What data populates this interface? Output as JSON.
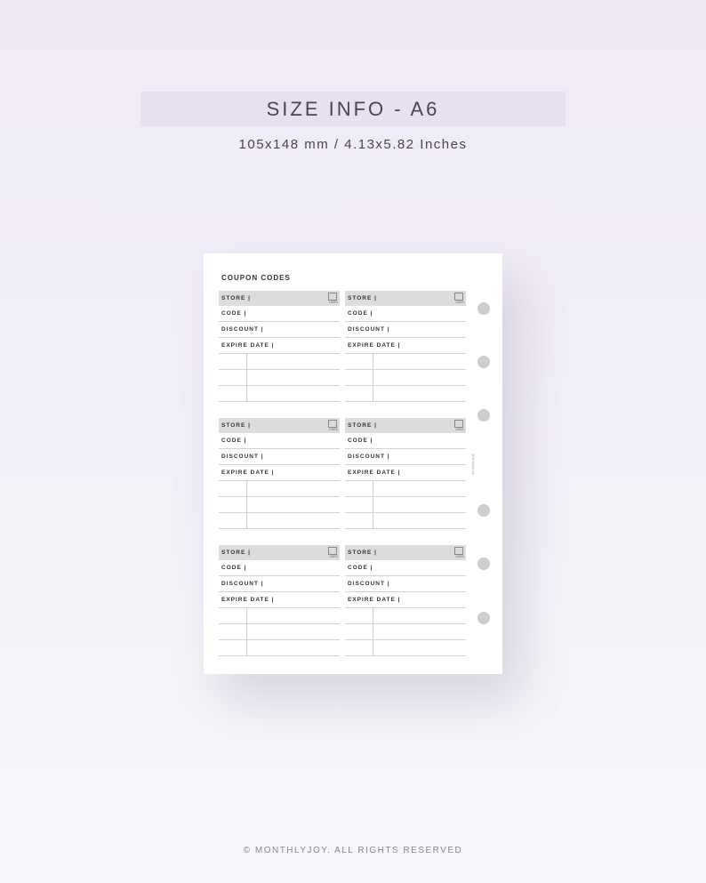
{
  "header": {
    "title": "SIZE INFO - A6",
    "subtitle": "105x148 mm / 4.13x5.82 Inches"
  },
  "planner": {
    "heading": "COUPON CODES",
    "store_label": "STORE |",
    "code_label": "CODE |",
    "discount_label": "DISCOUNT |",
    "expire_label": "EXPIRE DATE |",
    "used_label": "USED",
    "watermark": "@MonthlyJoy",
    "card_count": 6,
    "hole_count": 6
  },
  "footer": "© MONTHLYJOY. ALL RIGHTS RESERVED"
}
